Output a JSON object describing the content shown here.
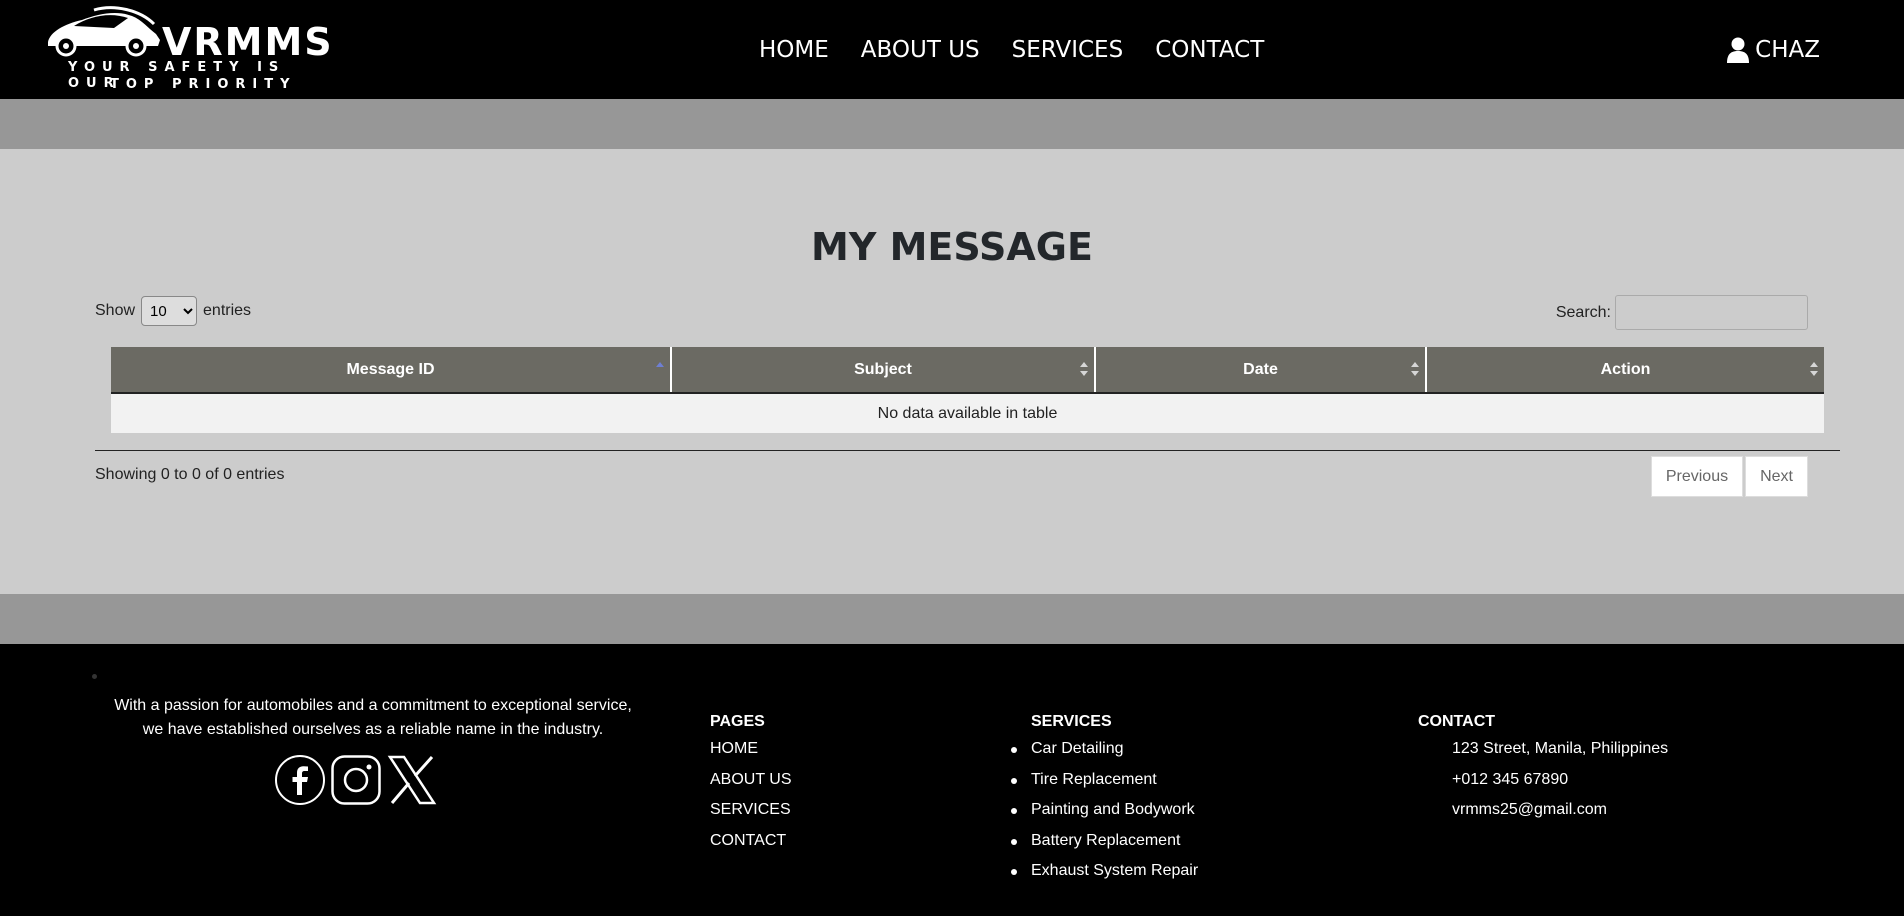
{
  "header": {
    "logo_name": "VRMMS",
    "tagline_line1": "YOUR SAFETY IS OUR",
    "tagline_line2": "TOP PRIORITY",
    "nav": [
      "HOME",
      "ABOUT US",
      "SERVICES",
      "CONTACT"
    ],
    "user_name": "CHAZ",
    "user_icon": "user-icon"
  },
  "main": {
    "title": "MY MESSAGE",
    "show_label": "Show",
    "entries_label": "entries",
    "page_length": "10",
    "search_label": "Search:",
    "columns": [
      "Message ID",
      "Subject",
      "Date",
      "Action"
    ],
    "empty_message": "No data available in table",
    "info": "Showing 0 to 0 of 0 entries",
    "previous_label": "Previous",
    "next_label": "Next"
  },
  "footer": {
    "about_text": "With a passion for automobiles and a commitment to exceptional service, we have established ourselves as a reliable name in the industry.",
    "social_icons": [
      "facebook-icon",
      "instagram-icon",
      "x-icon"
    ],
    "pages": {
      "heading": "PAGES",
      "items": [
        "HOME",
        "ABOUT US",
        "SERVICES",
        "CONTACT"
      ]
    },
    "services": {
      "heading": "SERVICES",
      "items": [
        "Car Detailing",
        "Tire Replacement",
        "Painting and Bodywork",
        "Battery Replacement",
        "Exhaust System Repair"
      ]
    },
    "contact": {
      "heading": "CONTACT",
      "address": "123 Street, Manila, Philippines",
      "phone": "+012 345 67890",
      "email": "vrmms25@gmail.com"
    }
  },
  "colors": {
    "header_bg": "#000000",
    "band_bg": "#979797",
    "main_bg": "#cccccc",
    "table_header_bg": "#6b6a63",
    "empty_row_bg": "#f2f2f2",
    "sort_active": "#6e7fd3"
  }
}
